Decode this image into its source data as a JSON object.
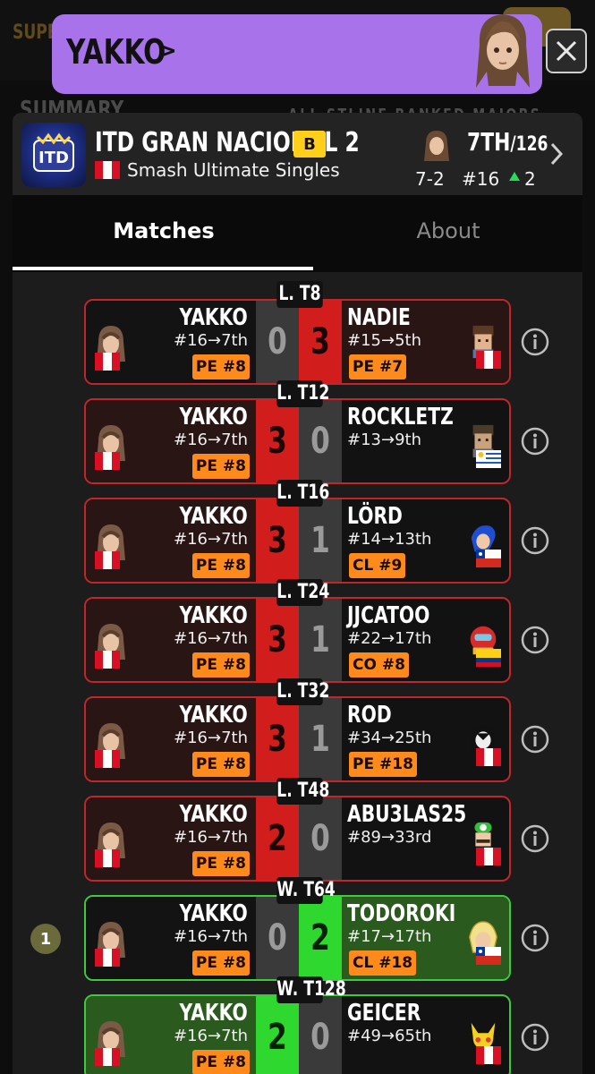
{
  "toast": {
    "player_name": "YAKKO",
    "chevron": ">",
    "close_icon": "close-icon"
  },
  "background": {
    "brand_text": "SUPE",
    "section_title": "SUMMARY",
    "filters": "ALL  STLINE  RANKED  MAJORS"
  },
  "event": {
    "name": "ITD GRAN NACIONAL 2",
    "logo_text": "ITD",
    "tier": "B",
    "country_flag": "peru-flag",
    "game": "Smash Ultimate Singles",
    "placing": "7TH",
    "entrants": "/126",
    "record": "7-2",
    "seed": "#16",
    "seed_delta": "2"
  },
  "tabs": [
    {
      "label": "Matches",
      "active": true
    },
    {
      "label": "About",
      "active": false
    }
  ],
  "matches": [
    {
      "round": "L. T8",
      "player": "YAKKO",
      "player_seed": "#16→7th",
      "player_tag": "PE #8",
      "player_score": "0",
      "opp_score": "3",
      "opponent": "NADIE",
      "opp_seed": "#15→5th",
      "opp_tag": "PE #7",
      "opp_flag": "peru-flag",
      "result": "loss"
    },
    {
      "round": "L. T12",
      "player": "YAKKO",
      "player_seed": "#16→7th",
      "player_tag": "PE #8",
      "player_score": "3",
      "opp_score": "0",
      "opponent": "ROCKLETZ",
      "opp_seed": "#13→9th",
      "opp_tag": "",
      "opp_flag": "uruguay-flag",
      "result": "win"
    },
    {
      "round": "L. T16",
      "player": "YAKKO",
      "player_seed": "#16→7th",
      "player_tag": "PE #8",
      "player_score": "3",
      "opp_score": "1",
      "opponent": "LÖRD",
      "opp_seed": "#14→13th",
      "opp_tag": "CL #9",
      "opp_flag": "chile-flag",
      "result": "win"
    },
    {
      "round": "L. T24",
      "player": "YAKKO",
      "player_seed": "#16→7th",
      "player_tag": "PE #8",
      "player_score": "3",
      "opp_score": "1",
      "opponent": "JJCATOO",
      "opp_seed": "#22→17th",
      "opp_tag": "CO #8",
      "opp_flag": "colombia-flag",
      "result": "win"
    },
    {
      "round": "L. T32",
      "player": "YAKKO",
      "player_seed": "#16→7th",
      "player_tag": "PE #8",
      "player_score": "3",
      "opp_score": "1",
      "opponent": "ROD",
      "opp_seed": "#34→25th",
      "opp_tag": "PE #18",
      "opp_flag": "peru-flag",
      "result": "win"
    },
    {
      "round": "L. T48",
      "player": "YAKKO",
      "player_seed": "#16→7th",
      "player_tag": "PE #8",
      "player_score": "2",
      "opp_score": "0",
      "opponent": "ABU3LAS25",
      "opp_seed": "#89→33rd",
      "opp_tag": "",
      "opp_flag": "peru-flag",
      "result": "win"
    },
    {
      "round": "W. T64",
      "player": "YAKKO",
      "player_seed": "#16→7th",
      "player_tag": "PE #8",
      "player_score": "0",
      "opp_score": "2",
      "opponent": "TODOROKI",
      "opp_seed": "#17→17th",
      "opp_tag": "CL #18",
      "opp_flag": "chile-flag",
      "result": "loss",
      "side_badge": "1"
    },
    {
      "round": "W. T128",
      "player": "YAKKO",
      "player_seed": "#16→7th",
      "player_tag": "PE #8",
      "player_score": "2",
      "opp_score": "0",
      "opponent": "GEICER",
      "opp_seed": "#49→65th",
      "opp_tag": "",
      "opp_flag": "peru-flag",
      "result": "win"
    }
  ],
  "colors": {
    "toast": "#a873ea",
    "tier_badge": "#ffcf1a",
    "tag": "#ff8a1c",
    "loss_red": "#d21d1d",
    "win_green": "#2ed82e",
    "trend_up": "#22dd55"
  }
}
